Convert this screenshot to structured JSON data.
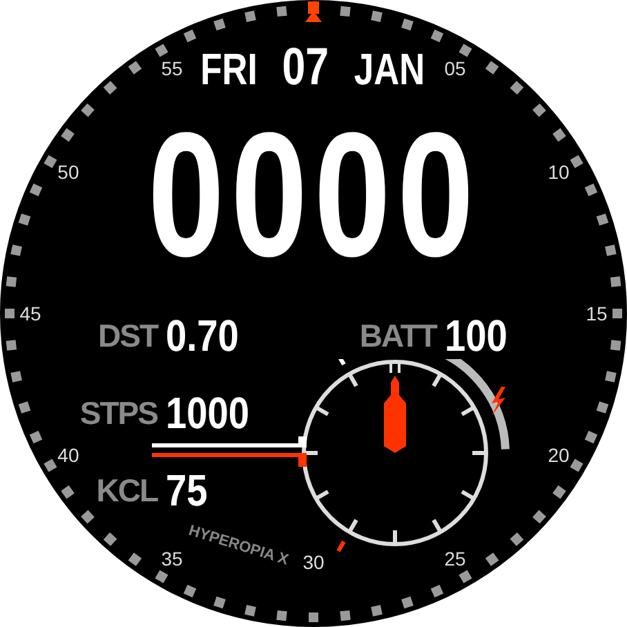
{
  "date": {
    "weekday": "FRI",
    "day": "07",
    "month": "JAN"
  },
  "time": "0000",
  "minute_labels": [
    "55",
    "05",
    "50",
    "10",
    "45",
    "15",
    "40",
    "20",
    "35",
    "30",
    "25"
  ],
  "brand": "HYPEROPIA X",
  "distance": {
    "label": "DST",
    "value": "0.70"
  },
  "battery": {
    "label": "BATT",
    "value": "100"
  },
  "steps": {
    "label": "STPS",
    "value": "1000",
    "level": 1
  },
  "calories": {
    "label": "KCL",
    "value": "75"
  }
}
